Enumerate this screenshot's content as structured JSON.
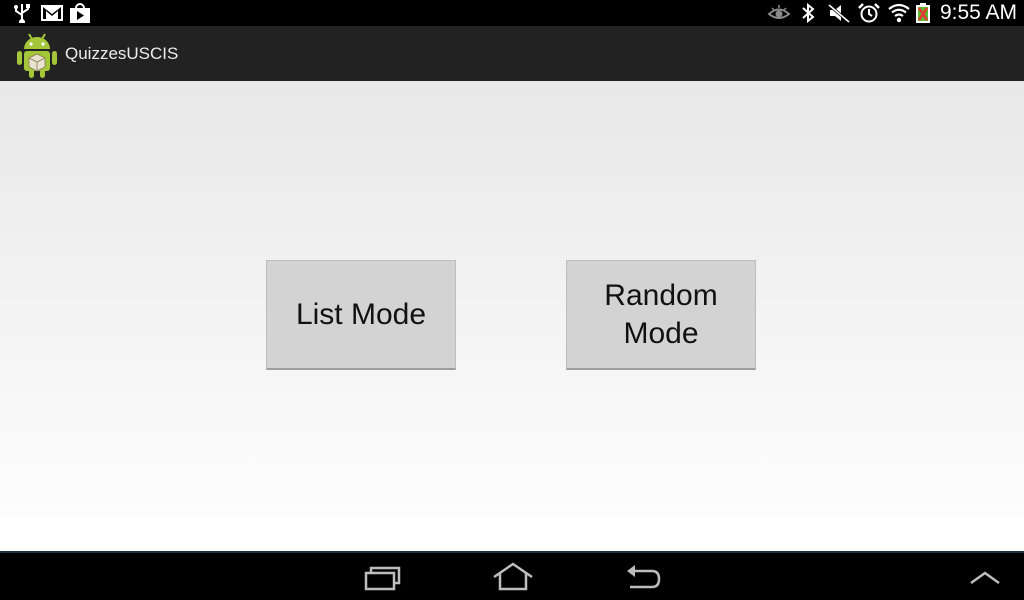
{
  "status_bar": {
    "time": "9:55 AM",
    "left_icons": [
      "usb-icon",
      "gmail-icon",
      "play-store-icon"
    ],
    "right_icons": [
      "eye-icon",
      "bluetooth-icon",
      "mute-icon",
      "alarm-icon",
      "wifi-icon",
      "battery-icon"
    ]
  },
  "action_bar": {
    "app_icon": "android-icon",
    "title": "QuizzesUSCIS"
  },
  "main": {
    "list_mode_label": "List Mode",
    "random_mode_label": "Random Mode"
  },
  "nav_bar": {
    "buttons": [
      "recent-apps-icon",
      "home-icon",
      "back-icon",
      "menu-up-icon"
    ]
  },
  "colors": {
    "status_bar_bg": "#000000",
    "action_bar_bg": "#222222",
    "button_bg": "#d3d3d3",
    "android_green": "#a4c639"
  }
}
